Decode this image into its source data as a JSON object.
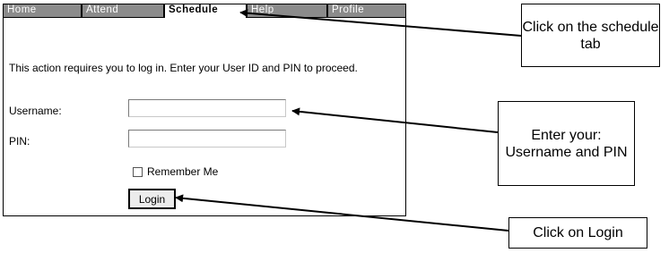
{
  "tabs": [
    {
      "label": "Home"
    },
    {
      "label": "Attend"
    },
    {
      "label": "Schedule",
      "active": true
    },
    {
      "label": "Help"
    },
    {
      "label": "Profile"
    }
  ],
  "login": {
    "message": "This action requires you to log in. Enter your User ID and PIN to proceed.",
    "username_label": "Username:",
    "username_value": "",
    "pin_label": "PIN:",
    "pin_value": "",
    "remember_label": "Remember Me",
    "remember_checked": false,
    "button_label": "Login"
  },
  "callouts": {
    "schedule_tab": "Click on the schedule tab",
    "credentials": "Enter your: Username and PIN",
    "login": "Click on Login"
  }
}
